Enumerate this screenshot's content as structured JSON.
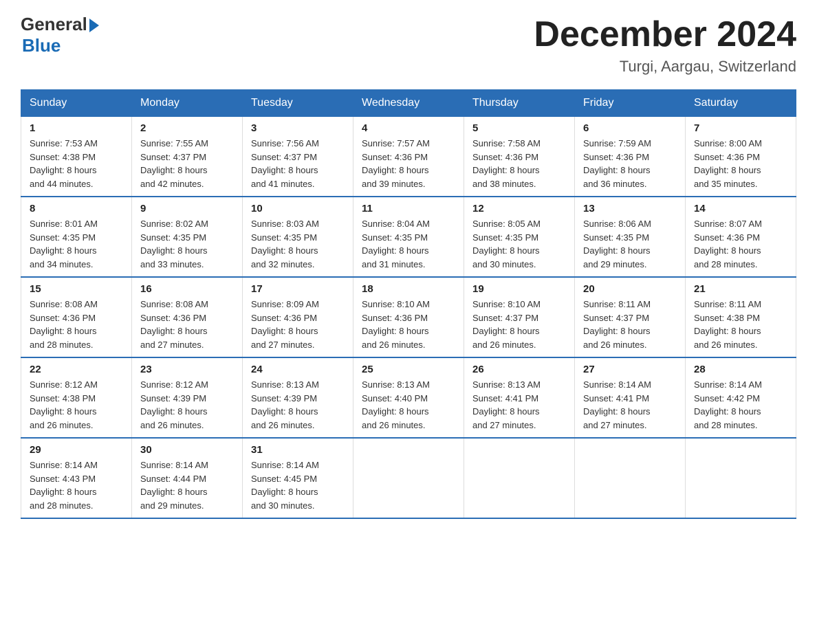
{
  "header": {
    "logo_general": "General",
    "logo_blue": "Blue",
    "month_title": "December 2024",
    "location": "Turgi, Aargau, Switzerland"
  },
  "weekdays": [
    "Sunday",
    "Monday",
    "Tuesday",
    "Wednesday",
    "Thursday",
    "Friday",
    "Saturday"
  ],
  "weeks": [
    [
      {
        "day": "1",
        "sunrise": "7:53 AM",
        "sunset": "4:38 PM",
        "daylight": "8 hours and 44 minutes."
      },
      {
        "day": "2",
        "sunrise": "7:55 AM",
        "sunset": "4:37 PM",
        "daylight": "8 hours and 42 minutes."
      },
      {
        "day": "3",
        "sunrise": "7:56 AM",
        "sunset": "4:37 PM",
        "daylight": "8 hours and 41 minutes."
      },
      {
        "day": "4",
        "sunrise": "7:57 AM",
        "sunset": "4:36 PM",
        "daylight": "8 hours and 39 minutes."
      },
      {
        "day": "5",
        "sunrise": "7:58 AM",
        "sunset": "4:36 PM",
        "daylight": "8 hours and 38 minutes."
      },
      {
        "day": "6",
        "sunrise": "7:59 AM",
        "sunset": "4:36 PM",
        "daylight": "8 hours and 36 minutes."
      },
      {
        "day": "7",
        "sunrise": "8:00 AM",
        "sunset": "4:36 PM",
        "daylight": "8 hours and 35 minutes."
      }
    ],
    [
      {
        "day": "8",
        "sunrise": "8:01 AM",
        "sunset": "4:35 PM",
        "daylight": "8 hours and 34 minutes."
      },
      {
        "day": "9",
        "sunrise": "8:02 AM",
        "sunset": "4:35 PM",
        "daylight": "8 hours and 33 minutes."
      },
      {
        "day": "10",
        "sunrise": "8:03 AM",
        "sunset": "4:35 PM",
        "daylight": "8 hours and 32 minutes."
      },
      {
        "day": "11",
        "sunrise": "8:04 AM",
        "sunset": "4:35 PM",
        "daylight": "8 hours and 31 minutes."
      },
      {
        "day": "12",
        "sunrise": "8:05 AM",
        "sunset": "4:35 PM",
        "daylight": "8 hours and 30 minutes."
      },
      {
        "day": "13",
        "sunrise": "8:06 AM",
        "sunset": "4:35 PM",
        "daylight": "8 hours and 29 minutes."
      },
      {
        "day": "14",
        "sunrise": "8:07 AM",
        "sunset": "4:36 PM",
        "daylight": "8 hours and 28 minutes."
      }
    ],
    [
      {
        "day": "15",
        "sunrise": "8:08 AM",
        "sunset": "4:36 PM",
        "daylight": "8 hours and 28 minutes."
      },
      {
        "day": "16",
        "sunrise": "8:08 AM",
        "sunset": "4:36 PM",
        "daylight": "8 hours and 27 minutes."
      },
      {
        "day": "17",
        "sunrise": "8:09 AM",
        "sunset": "4:36 PM",
        "daylight": "8 hours and 27 minutes."
      },
      {
        "day": "18",
        "sunrise": "8:10 AM",
        "sunset": "4:36 PM",
        "daylight": "8 hours and 26 minutes."
      },
      {
        "day": "19",
        "sunrise": "8:10 AM",
        "sunset": "4:37 PM",
        "daylight": "8 hours and 26 minutes."
      },
      {
        "day": "20",
        "sunrise": "8:11 AM",
        "sunset": "4:37 PM",
        "daylight": "8 hours and 26 minutes."
      },
      {
        "day": "21",
        "sunrise": "8:11 AM",
        "sunset": "4:38 PM",
        "daylight": "8 hours and 26 minutes."
      }
    ],
    [
      {
        "day": "22",
        "sunrise": "8:12 AM",
        "sunset": "4:38 PM",
        "daylight": "8 hours and 26 minutes."
      },
      {
        "day": "23",
        "sunrise": "8:12 AM",
        "sunset": "4:39 PM",
        "daylight": "8 hours and 26 minutes."
      },
      {
        "day": "24",
        "sunrise": "8:13 AM",
        "sunset": "4:39 PM",
        "daylight": "8 hours and 26 minutes."
      },
      {
        "day": "25",
        "sunrise": "8:13 AM",
        "sunset": "4:40 PM",
        "daylight": "8 hours and 26 minutes."
      },
      {
        "day": "26",
        "sunrise": "8:13 AM",
        "sunset": "4:41 PM",
        "daylight": "8 hours and 27 minutes."
      },
      {
        "day": "27",
        "sunrise": "8:14 AM",
        "sunset": "4:41 PM",
        "daylight": "8 hours and 27 minutes."
      },
      {
        "day": "28",
        "sunrise": "8:14 AM",
        "sunset": "4:42 PM",
        "daylight": "8 hours and 28 minutes."
      }
    ],
    [
      {
        "day": "29",
        "sunrise": "8:14 AM",
        "sunset": "4:43 PM",
        "daylight": "8 hours and 28 minutes."
      },
      {
        "day": "30",
        "sunrise": "8:14 AM",
        "sunset": "4:44 PM",
        "daylight": "8 hours and 29 minutes."
      },
      {
        "day": "31",
        "sunrise": "8:14 AM",
        "sunset": "4:45 PM",
        "daylight": "8 hours and 30 minutes."
      },
      null,
      null,
      null,
      null
    ]
  ],
  "labels": {
    "sunrise": "Sunrise: ",
    "sunset": "Sunset: ",
    "daylight": "Daylight: "
  }
}
